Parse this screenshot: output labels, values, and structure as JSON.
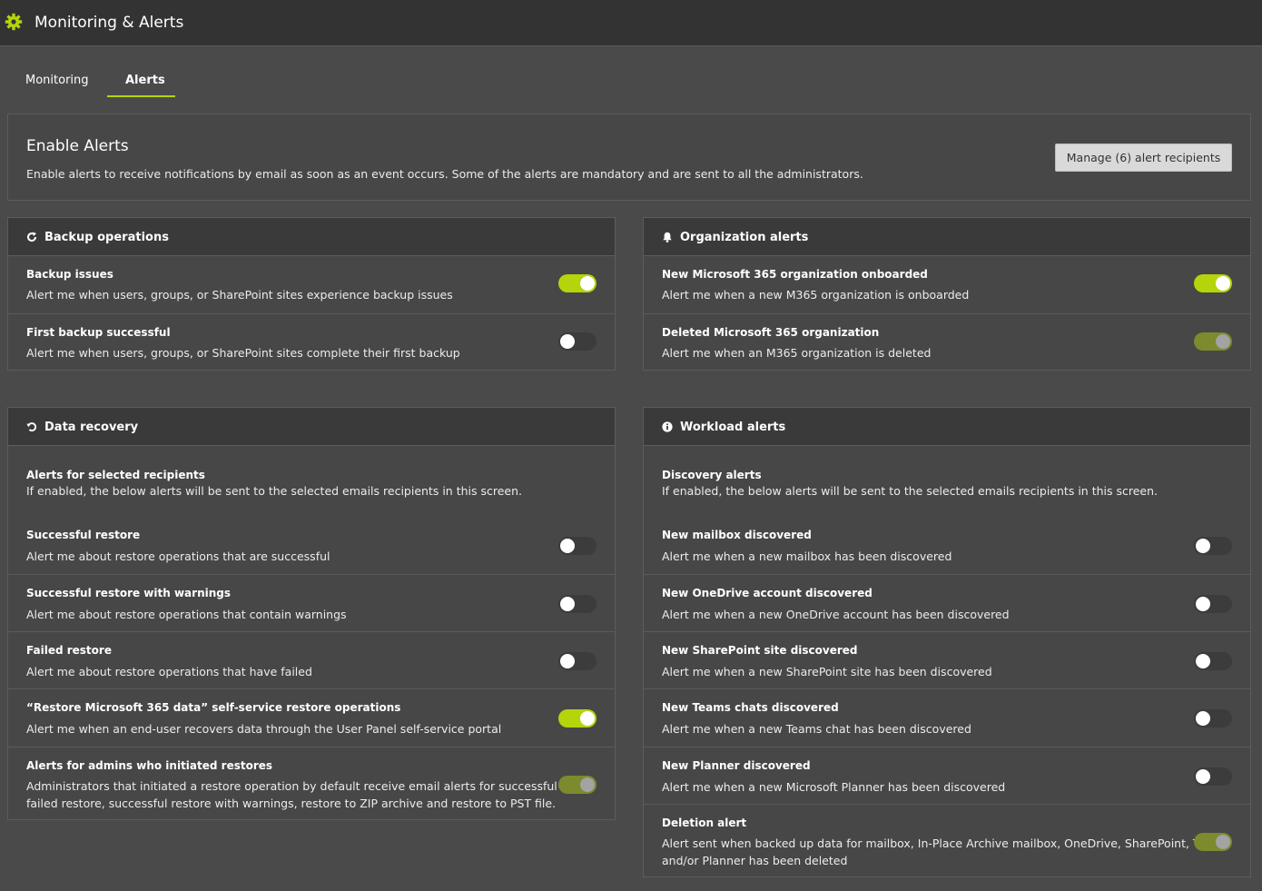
{
  "header": {
    "title": "Monitoring & Alerts",
    "accent": "#b5d40c"
  },
  "tabs": [
    {
      "label": "Monitoring",
      "active": false
    },
    {
      "label": "Alerts",
      "active": true
    }
  ],
  "enable": {
    "title": "Enable Alerts",
    "description": "Enable alerts to receive notifications by email as soon as an event occurs. Some of the alerts are mandatory and are sent to all the administrators.",
    "manage_label": "Manage (6) alert recipients"
  },
  "backup": {
    "title": "Backup operations",
    "icon": "refresh-icon",
    "rows": [
      {
        "title": "Backup issues",
        "desc": "Alert me when users, groups, or SharePoint sites experience backup issues",
        "state": "on"
      },
      {
        "title": "First backup successful",
        "desc": "Alert me when users, groups, or SharePoint sites complete their first backup",
        "state": "off"
      }
    ]
  },
  "org": {
    "title": "Organization alerts",
    "icon": "bell-icon",
    "rows": [
      {
        "title": "New Microsoft 365 organization onboarded",
        "desc": "Alert me when a new M365 organization is onboarded",
        "state": "on"
      },
      {
        "title": "Deleted Microsoft 365 organization",
        "desc": "Alert me when an M365 organization is deleted",
        "state": "disabled"
      }
    ]
  },
  "recovery": {
    "title": "Data recovery",
    "icon": "undo-icon",
    "intro_title": "Alerts for selected recipients",
    "intro_desc": "If enabled, the below alerts will be sent to the selected emails recipients in this screen.",
    "rows": [
      {
        "title": "Successful restore",
        "desc": "Alert me about restore operations that are successful",
        "state": "off"
      },
      {
        "title": "Successful restore with warnings",
        "desc": "Alert me about restore operations that contain warnings",
        "state": "off"
      },
      {
        "title": "Failed restore",
        "desc": "Alert me about restore operations that have failed",
        "state": "off"
      },
      {
        "title": "“Restore Microsoft 365 data” self-service restore operations",
        "desc": "Alert me when an end-user recovers data through the User Panel self-service portal",
        "state": "on"
      },
      {
        "title": "Alerts for admins who initiated restores",
        "desc_line1": "Administrators that initiated a restore operation by default receive email alerts for successful or",
        "desc_line2": "failed restore, successful restore with warnings, restore to ZIP archive and restore to PST file.",
        "state": "disabled"
      }
    ]
  },
  "workload": {
    "title": "Workload alerts",
    "icon": "info-icon",
    "intro_title": "Discovery alerts",
    "intro_desc": "If enabled, the below alerts will be sent to the selected emails recipients in this screen.",
    "rows": [
      {
        "title": "New mailbox discovered",
        "desc": "Alert me when a new mailbox has been discovered",
        "state": "off"
      },
      {
        "title": "New OneDrive account discovered",
        "desc": "Alert me when a new OneDrive account has been discovered",
        "state": "off"
      },
      {
        "title": "New SharePoint site discovered",
        "desc": "Alert me when a new SharePoint site has been discovered",
        "state": "off"
      },
      {
        "title": "New Teams chats discovered",
        "desc": "Alert me when a new Teams chat has been discovered",
        "state": "off"
      },
      {
        "title": "New Planner discovered",
        "desc": "Alert me when a new Microsoft Planner has been discovered",
        "state": "off"
      },
      {
        "title": "Deletion alert",
        "desc_line1": "Alert sent when backed up data for mailbox, In-Place Archive mailbox, OneDrive, SharePoint, Teams",
        "desc_line2": "and/or Planner has been deleted",
        "state": "disabled"
      }
    ]
  }
}
